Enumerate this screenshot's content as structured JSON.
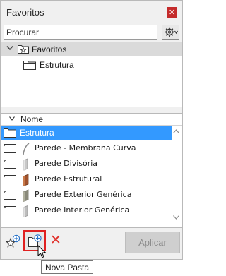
{
  "window": {
    "title": "Favoritos",
    "close_icon": "close-icon"
  },
  "search": {
    "placeholder": "Procurar",
    "value": ""
  },
  "tree": {
    "root_label": "Favoritos",
    "expanded": true,
    "children": [
      {
        "label": "Estrutura"
      }
    ]
  },
  "list": {
    "header": {
      "name_column": "Nome"
    },
    "selected_folder": "Estrutura",
    "items": [
      {
        "label": "Parede - Membrana Curva",
        "icon": "curved-membrane-wall-thumbnail"
      },
      {
        "label": "Parede Divisória",
        "icon": "partition-wall-thumbnail"
      },
      {
        "label": "Parede Estrutural",
        "icon": "structural-wall-thumbnail"
      },
      {
        "label": "Parede Exterior Genérica",
        "icon": "exterior-wall-thumbnail"
      },
      {
        "label": "Parede Interior Genérica",
        "icon": "interior-wall-thumbnail"
      }
    ]
  },
  "toolbar": {
    "add_favorite_icon": "star-plus-icon",
    "new_folder_icon": "folder-plus-icon",
    "delete_icon": "red-x-icon",
    "apply_label": "Aplicar",
    "apply_enabled": false
  },
  "tooltip": {
    "text": "Nova Pasta"
  },
  "colors": {
    "selection": "#3399ff",
    "close_button": "#c42b2b",
    "highlight_border": "#e02020",
    "delete": "#e0302a"
  }
}
